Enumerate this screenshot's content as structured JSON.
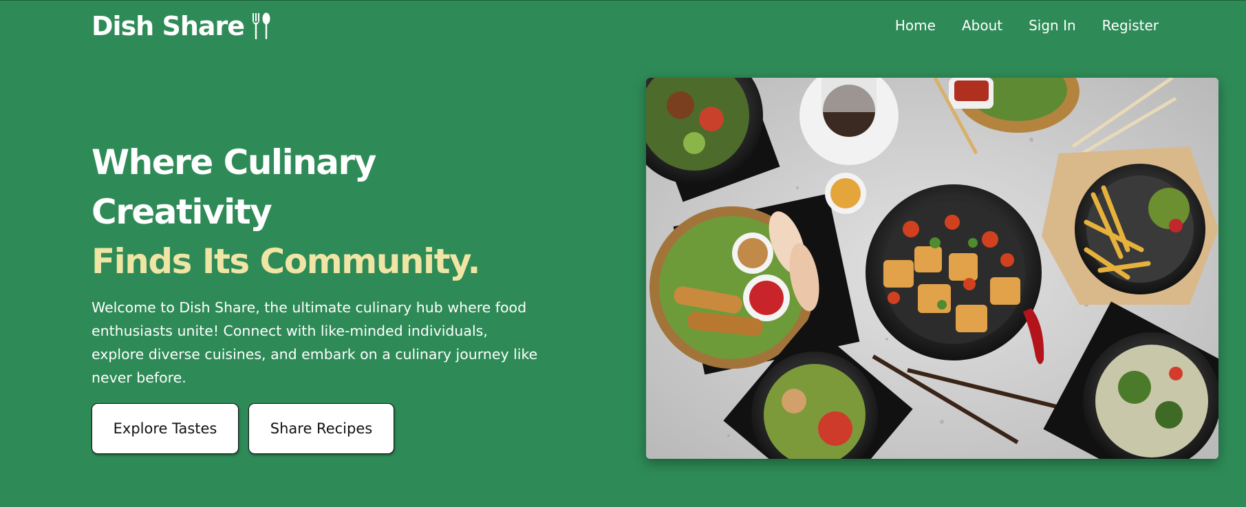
{
  "header": {
    "brand": "Dish Share",
    "brand_icon": "fork-spoon-icon",
    "nav": [
      {
        "label": "Home"
      },
      {
        "label": "About"
      },
      {
        "label": "Sign In"
      },
      {
        "label": "Register"
      }
    ]
  },
  "hero": {
    "title_line1": "Where Culinary Creativity",
    "title_line2": "Finds Its Community.",
    "description": "Welcome to Dish Share, the ultimate culinary hub where food enthusiasts unite! Connect with like-minded individuals, explore diverse cuisines, and embark on a culinary journey like never before.",
    "buttons": {
      "explore": "Explore Tastes",
      "share": "Share Recipes"
    },
    "image_icon": "food-spread-image"
  },
  "colors": {
    "background": "#2e8b57",
    "accent_text": "#f0e5a5",
    "button_bg": "#ffffff",
    "text": "#ffffff"
  }
}
